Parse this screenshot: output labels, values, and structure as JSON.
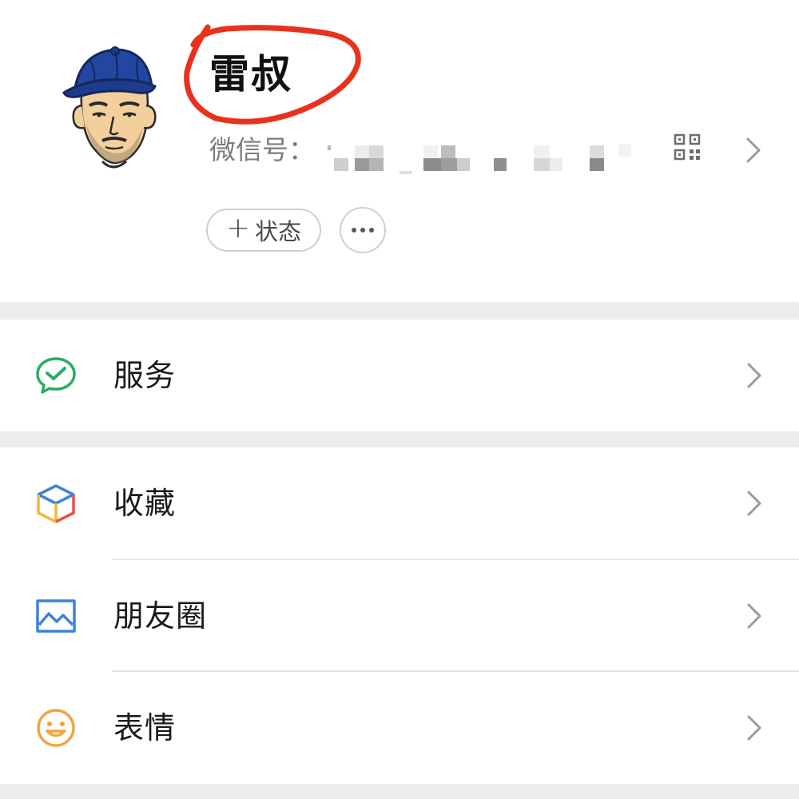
{
  "profile": {
    "name": "雷叔",
    "wechat_id_label": "微信号：",
    "status_button_label": "状态",
    "status_button_plus": "+",
    "more_button_icon": "more-dots-icon",
    "qr_icon": "qr-code-icon",
    "chevron_icon": "chevron-right-icon"
  },
  "menu": {
    "items": [
      {
        "label": "服务",
        "icon": "wechat-pay-check-icon",
        "icon_color": "#2aae67"
      },
      {
        "label": "收藏",
        "icon": "favorites-cube-icon",
        "icon_colors": [
          "#e8524a",
          "#f1b934",
          "#3c86d8"
        ]
      },
      {
        "label": "朋友圈",
        "icon": "moments-picture-icon",
        "icon_color": "#3d84d8"
      },
      {
        "label": "表情",
        "icon": "sticker-smiley-icon",
        "icon_color": "#efa640"
      }
    ]
  },
  "colors": {
    "background": "#ffffff",
    "separator": "#ececec",
    "secondary_text": "#7d7d7d",
    "annotation_circle": "#e8321e"
  }
}
